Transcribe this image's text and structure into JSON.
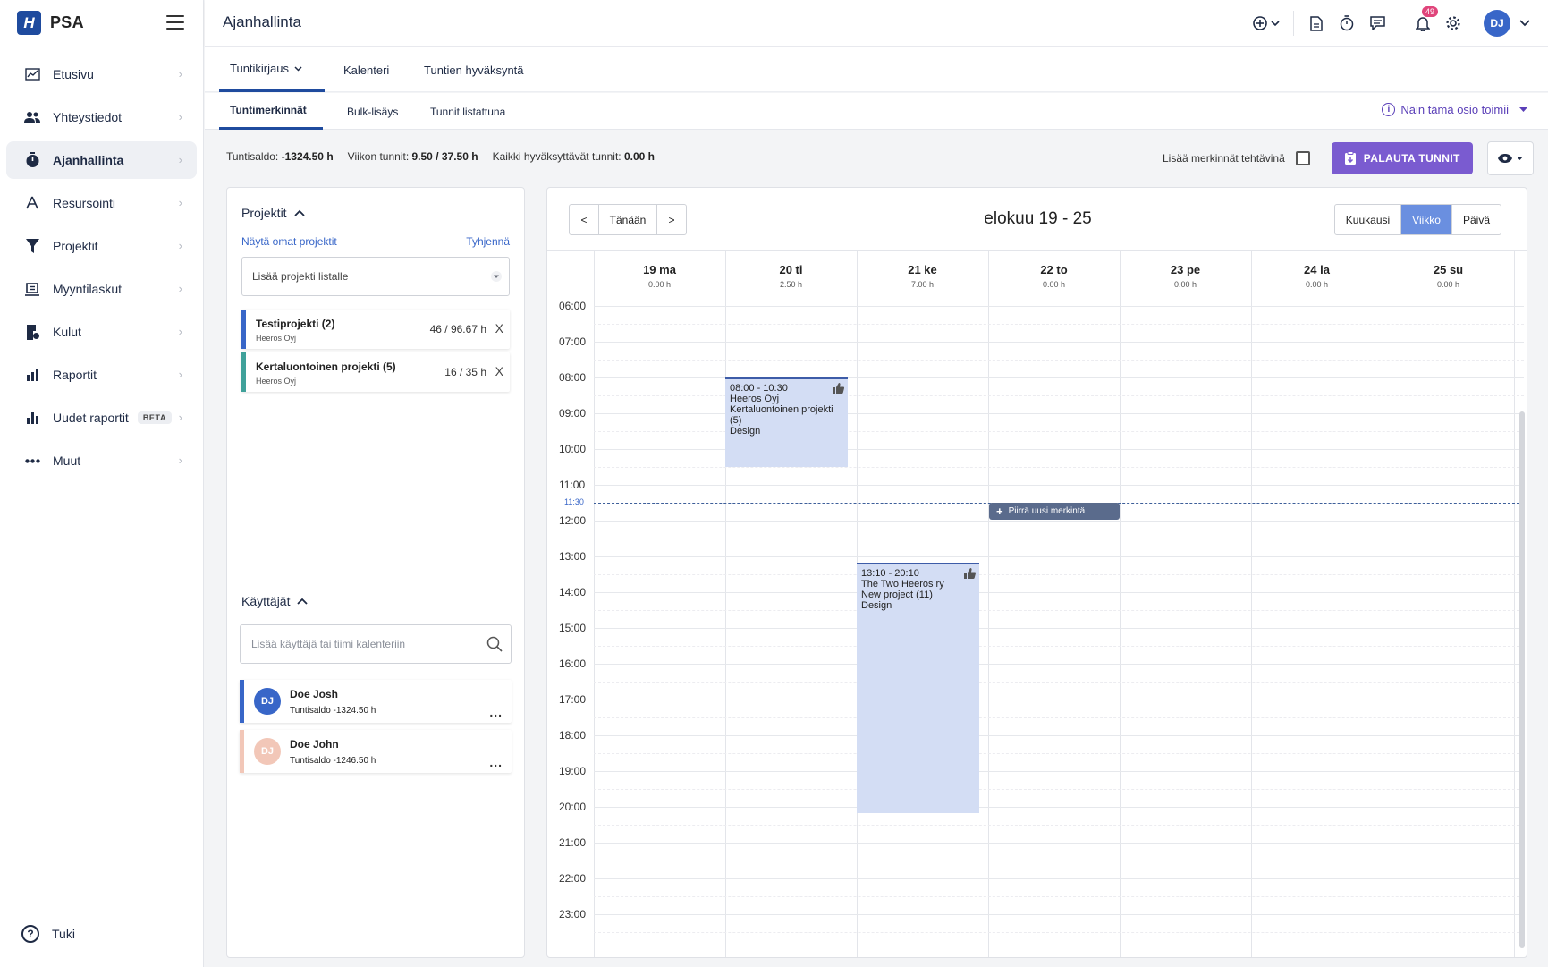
{
  "app": {
    "logo_letter": "H",
    "name": "PSA"
  },
  "sidebar": {
    "items": [
      {
        "label": "Etusivu",
        "icon": "chart-line-icon"
      },
      {
        "label": "Yhteystiedot",
        "icon": "people-icon"
      },
      {
        "label": "Ajanhallinta",
        "icon": "stopwatch-icon",
        "active": true
      },
      {
        "label": "Resursointi",
        "icon": "resource-icon"
      },
      {
        "label": "Projektit",
        "icon": "funnel-icon"
      },
      {
        "label": "Myyntilaskut",
        "icon": "invoice-icon"
      },
      {
        "label": "Kulut",
        "icon": "receipt-icon"
      },
      {
        "label": "Raportit",
        "icon": "bar-chart-icon"
      },
      {
        "label": "Uudet raportit",
        "icon": "bar-chart-icon",
        "badge": "BETA"
      },
      {
        "label": "Muut",
        "icon": "more-icon"
      }
    ],
    "help_label": "Tuki"
  },
  "header": {
    "title": "Ajanhallinta",
    "notifications_count": "49",
    "user_initials": "DJ"
  },
  "tabs": [
    {
      "label": "Tuntikirjaus",
      "active": true
    },
    {
      "label": "Kalenteri"
    },
    {
      "label": "Tuntien hyväksyntä"
    }
  ],
  "subtabs": [
    {
      "label": "Tuntimerkinnät",
      "active": true
    },
    {
      "label": "Bulk-lisäys"
    },
    {
      "label": "Tunnit listattuna"
    }
  ],
  "help_link": "Näin tämä osio toimii",
  "stats": {
    "balance_label": "Tuntisaldo:",
    "balance_value": "-1324.50 h",
    "week_label": "Viikon tunnit:",
    "week_value": "9.50 / 37.50 h",
    "approve_label": "Kaikki hyväksyttävät tunnit:",
    "approve_value": "0.00 h"
  },
  "actions": {
    "as_tasks_label": "Lisää merkinnät tehtävinä",
    "return_button": "PALAUTA TUNNIT"
  },
  "projects": {
    "title": "Projektit",
    "show_own": "Näytä omat projektit",
    "clear": "Tyhjennä",
    "add_placeholder": "Lisää projekti listalle",
    "items": [
      {
        "name": "Testiprojekti (2)",
        "client": "Heeros Oyj",
        "hours": "46 / 96.67 h",
        "color": "#3866c8",
        "remove": "X"
      },
      {
        "name": "Kertaluontoinen projekti (5)",
        "client": "Heeros Oyj",
        "hours": "16 / 35 h",
        "color": "#3fa19a",
        "remove": "X"
      }
    ]
  },
  "users": {
    "title": "Käyttäjät",
    "search_placeholder": "Lisää käyttäjä tai tiimi kalenteriin",
    "items": [
      {
        "initials": "DJ",
        "name": "Doe Josh",
        "balance": "Tuntisaldo -1324.50 h",
        "color": "#3866c8",
        "bar": "#3866c8",
        "more": "..."
      },
      {
        "initials": "DJ",
        "name": "Doe John",
        "balance": "Tuntisaldo -1246.50 h",
        "color": "#f2c7b8",
        "bar": "#f2c7b8",
        "more": "..."
      }
    ]
  },
  "calendar": {
    "prev": "<",
    "today": "Tänään",
    "next": ">",
    "title": "elokuu 19 - 25",
    "views": [
      "Kuukausi",
      "Viikko",
      "Päivä"
    ],
    "active_view": "Viikko",
    "days": [
      {
        "name": "19 ma",
        "hours": "0.00 h"
      },
      {
        "name": "20 ti",
        "hours": "2.50 h"
      },
      {
        "name": "21 ke",
        "hours": "7.00 h"
      },
      {
        "name": "22 to",
        "hours": "0.00 h"
      },
      {
        "name": "23 pe",
        "hours": "0.00 h"
      },
      {
        "name": "24 la",
        "hours": "0.00 h"
      },
      {
        "name": "25 su",
        "hours": "0.00 h"
      }
    ],
    "hours": [
      "06:00",
      "07:00",
      "08:00",
      "09:00",
      "10:00",
      "11:00",
      "12:00",
      "13:00",
      "14:00",
      "15:00",
      "16:00",
      "17:00",
      "18:00",
      "19:00",
      "20:00",
      "21:00",
      "22:00",
      "23:00"
    ],
    "now_label": "11:30",
    "draw_new": "Piirrä uusi merkintä",
    "events": [
      {
        "day": 1,
        "start": "08:00",
        "end": "10:30",
        "time": "08:00 - 10:30",
        "client": "Heeros Oyj",
        "project": "Kertaluontoinen projekti (5)",
        "task": "Design"
      },
      {
        "day": 2,
        "start": "13:10",
        "end": "20:10",
        "time": "13:10 - 20:10",
        "client": "The Two Heeros ry",
        "project": "New project (11)",
        "task": "Design"
      }
    ]
  },
  "colors": {
    "accent": "#1f4b9e",
    "primary_button": "#7a5bd0",
    "event_fill": "#d3ddf4",
    "link": "#3866c8"
  }
}
